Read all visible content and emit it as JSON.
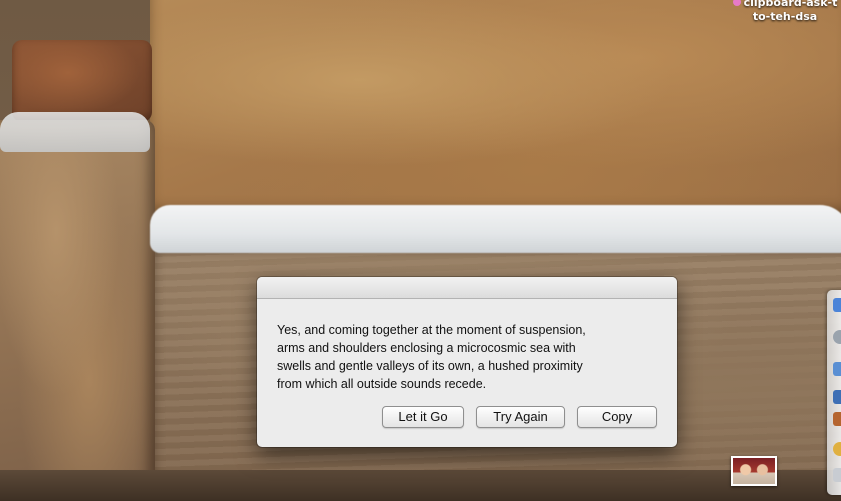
{
  "desktop": {
    "file_label_line1": "clipboard-ask-t",
    "file_label_line2": "to-teh-dsa",
    "file_tag_color": "#e77ac7"
  },
  "dialog": {
    "message_lines": [
      "Yes, and coming together at the moment of suspension,",
      "arms and shoulders enclosing a microcosmic sea with",
      "swells and gentle valleys of its own, a hushed proximity",
      "from which all outside sounds recede."
    ],
    "buttons": {
      "let_it_go": "Let it Go",
      "try_again": "Try Again",
      "copy": "Copy"
    }
  }
}
